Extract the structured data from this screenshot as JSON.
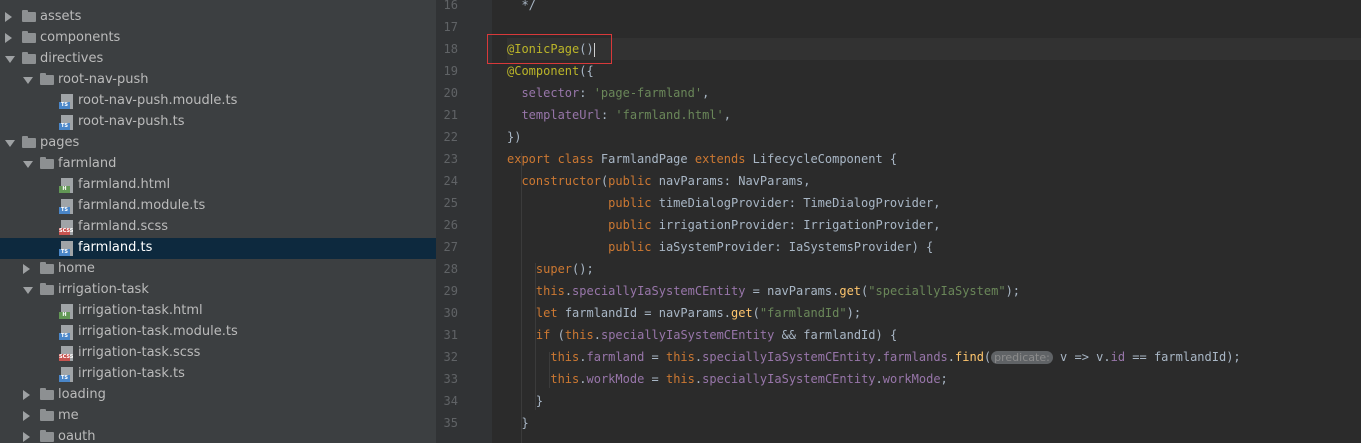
{
  "tree": [
    {
      "label": "assets",
      "kind": "folder",
      "depth": 0,
      "state": "collapsed"
    },
    {
      "label": "components",
      "kind": "folder",
      "depth": 0,
      "state": "collapsed"
    },
    {
      "label": "directives",
      "kind": "folder",
      "depth": 0,
      "state": "expanded"
    },
    {
      "label": "root-nav-push",
      "kind": "folder",
      "depth": 1,
      "state": "expanded"
    },
    {
      "label": "root-nav-push.moudle.ts",
      "kind": "ts",
      "depth": 2
    },
    {
      "label": "root-nav-push.ts",
      "kind": "ts",
      "depth": 2
    },
    {
      "label": "pages",
      "kind": "folder",
      "depth": 0,
      "state": "expanded"
    },
    {
      "label": "farmland",
      "kind": "folder",
      "depth": 1,
      "state": "expanded"
    },
    {
      "label": "farmland.html",
      "kind": "html",
      "depth": 2
    },
    {
      "label": "farmland.module.ts",
      "kind": "ts",
      "depth": 2
    },
    {
      "label": "farmland.scss",
      "kind": "scss",
      "depth": 2
    },
    {
      "label": "farmland.ts",
      "kind": "ts",
      "depth": 2,
      "selected": true
    },
    {
      "label": "home",
      "kind": "folder",
      "depth": 1,
      "state": "collapsed"
    },
    {
      "label": "irrigation-task",
      "kind": "folder",
      "depth": 1,
      "state": "expanded"
    },
    {
      "label": "irrigation-task.html",
      "kind": "html",
      "depth": 2
    },
    {
      "label": "irrigation-task.module.ts",
      "kind": "ts",
      "depth": 2
    },
    {
      "label": "irrigation-task.scss",
      "kind": "scss",
      "depth": 2
    },
    {
      "label": "irrigation-task.ts",
      "kind": "ts",
      "depth": 2
    },
    {
      "label": "loading",
      "kind": "folder",
      "depth": 1,
      "state": "collapsed"
    },
    {
      "label": "me",
      "kind": "folder",
      "depth": 1,
      "state": "collapsed"
    },
    {
      "label": "oauth",
      "kind": "folder",
      "depth": 1,
      "state": "collapsed"
    }
  ],
  "icon_badges": {
    "ts": "TS",
    "html": "H",
    "scss": "SCSS"
  },
  "icon_colors": {
    "ts": "#4a86c8",
    "html": "#629755",
    "scss": "#c75450",
    "folder": "#8d9092"
  },
  "code": [
    {
      "n": "16",
      "tokens": [
        [
          "plain",
          "  */"
        ]
      ]
    },
    {
      "n": "17",
      "tokens": []
    },
    {
      "n": "18",
      "current": true,
      "tokens": [
        [
          "ann",
          "@IonicPage"
        ],
        [
          "plain",
          "()"
        ],
        [
          "caret",
          ""
        ]
      ]
    },
    {
      "n": "19",
      "tokens": [
        [
          "ann",
          "@Component"
        ],
        [
          "plain",
          "({"
        ]
      ]
    },
    {
      "n": "20",
      "tokens": [
        [
          "plain",
          "  "
        ],
        [
          "fld",
          "selector"
        ],
        [
          "plain",
          ": "
        ],
        [
          "str",
          "'page-farmland'"
        ],
        [
          "plain",
          ","
        ]
      ]
    },
    {
      "n": "21",
      "tokens": [
        [
          "plain",
          "  "
        ],
        [
          "fld",
          "templateUrl"
        ],
        [
          "plain",
          ": "
        ],
        [
          "str",
          "'farmland.html'"
        ],
        [
          "plain",
          ","
        ]
      ]
    },
    {
      "n": "22",
      "tokens": [
        [
          "plain",
          "})"
        ]
      ]
    },
    {
      "n": "23",
      "tokens": [
        [
          "kw",
          "export class "
        ],
        [
          "plain",
          "FarmlandPage "
        ],
        [
          "kw",
          "extends "
        ],
        [
          "plain",
          "LifecycleComponent {"
        ]
      ]
    },
    {
      "n": "24",
      "tokens": [
        [
          "plain",
          "  "
        ],
        [
          "kw",
          "constructor"
        ],
        [
          "plain",
          "("
        ],
        [
          "kw",
          "public "
        ],
        [
          "plain",
          "navParams: NavParams,"
        ]
      ]
    },
    {
      "n": "25",
      "tokens": [
        [
          "plain",
          "              "
        ],
        [
          "kw",
          "public "
        ],
        [
          "plain",
          "timeDialogProvider: TimeDialogProvider,"
        ]
      ]
    },
    {
      "n": "26",
      "tokens": [
        [
          "plain",
          "              "
        ],
        [
          "kw",
          "public "
        ],
        [
          "plain",
          "irrigationProvider: IrrigationProvider,"
        ]
      ]
    },
    {
      "n": "27",
      "tokens": [
        [
          "plain",
          "              "
        ],
        [
          "kw",
          "public "
        ],
        [
          "plain",
          "iaSystemProvider: IaSystemsProvider) {"
        ]
      ]
    },
    {
      "n": "28",
      "tokens": [
        [
          "plain",
          "    "
        ],
        [
          "kw",
          "super"
        ],
        [
          "plain",
          "();"
        ]
      ]
    },
    {
      "n": "29",
      "tokens": [
        [
          "plain",
          "    "
        ],
        [
          "kw",
          "this"
        ],
        [
          "plain",
          "."
        ],
        [
          "fld",
          "speciallyIaSystemCEntity"
        ],
        [
          "plain",
          " = navParams."
        ],
        [
          "fn",
          "get"
        ],
        [
          "plain",
          "("
        ],
        [
          "str",
          "\"speciallyIaSystem\""
        ],
        [
          "plain",
          ");"
        ]
      ]
    },
    {
      "n": "30",
      "tokens": [
        [
          "plain",
          "    "
        ],
        [
          "kw",
          "let "
        ],
        [
          "plain",
          "farmlandId = navParams."
        ],
        [
          "fn",
          "get"
        ],
        [
          "plain",
          "("
        ],
        [
          "str",
          "\"farmlandId\""
        ],
        [
          "plain",
          ");"
        ]
      ]
    },
    {
      "n": "31",
      "tokens": [
        [
          "plain",
          "    "
        ],
        [
          "kw",
          "if "
        ],
        [
          "plain",
          "("
        ],
        [
          "kw",
          "this"
        ],
        [
          "plain",
          "."
        ],
        [
          "fld",
          "speciallyIaSystemCEntity"
        ],
        [
          "plain",
          " && farmlandId) {"
        ]
      ]
    },
    {
      "n": "32",
      "tokens": [
        [
          "plain",
          "      "
        ],
        [
          "kw",
          "this"
        ],
        [
          "plain",
          "."
        ],
        [
          "fld",
          "farmland"
        ],
        [
          "plain",
          " = "
        ],
        [
          "kw",
          "this"
        ],
        [
          "plain",
          "."
        ],
        [
          "fld",
          "speciallyIaSystemCEntity"
        ],
        [
          "plain",
          "."
        ],
        [
          "fld",
          "farmlands"
        ],
        [
          "plain",
          "."
        ],
        [
          "fn",
          "find"
        ],
        [
          "plain",
          "("
        ],
        [
          "hint",
          "predicate:"
        ],
        [
          "plain",
          " v => v."
        ],
        [
          "fld",
          "id"
        ],
        [
          "plain",
          " == farmlandId);"
        ]
      ]
    },
    {
      "n": "33",
      "tokens": [
        [
          "plain",
          "      "
        ],
        [
          "kw",
          "this"
        ],
        [
          "plain",
          "."
        ],
        [
          "fld",
          "workMode"
        ],
        [
          "plain",
          " = "
        ],
        [
          "kw",
          "this"
        ],
        [
          "plain",
          "."
        ],
        [
          "fld",
          "speciallyIaSystemCEntity"
        ],
        [
          "plain",
          "."
        ],
        [
          "fld",
          "workMode"
        ],
        [
          "plain",
          ";"
        ]
      ]
    },
    {
      "n": "34",
      "tokens": [
        [
          "plain",
          "    }"
        ]
      ]
    },
    {
      "n": "35",
      "tokens": [
        [
          "plain",
          "  }"
        ]
      ]
    }
  ]
}
